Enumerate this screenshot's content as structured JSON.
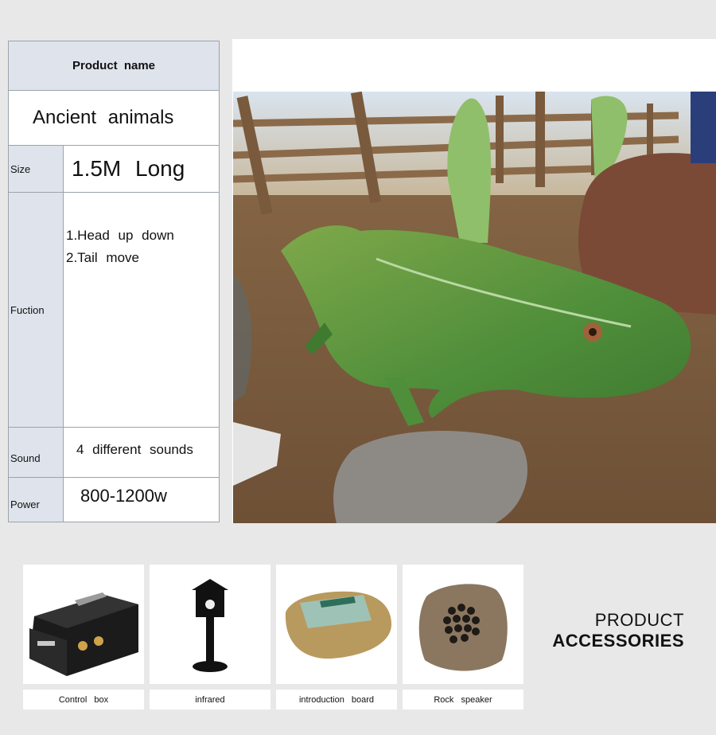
{
  "spec_table": {
    "header": "Product name",
    "product_name": "Ancient animals",
    "size_label": "Size",
    "size_value": "1.5M Long",
    "function_label": "Fuction",
    "function_lines": [
      "1.Head up down",
      "2.Tail move"
    ],
    "sound_label": "Sound",
    "sound_value": "4 different sounds",
    "power_label": "Power",
    "power_value": "800-1200w"
  },
  "accessories": {
    "title_line1": "PRODUCT",
    "title_line2": "ACCESSORIES",
    "items": [
      {
        "label": "Control box",
        "icon": "control-box-icon"
      },
      {
        "label": "infrared",
        "icon": "infrared-sensor-icon"
      },
      {
        "label": "introduction board",
        "icon": "introduction-board-icon"
      },
      {
        "label": "Rock speaker",
        "icon": "rock-speaker-icon"
      }
    ]
  },
  "colors": {
    "label_bg": "#dfe4ec",
    "border": "#9aa3ad",
    "page_bg": "#e8e8e8"
  }
}
